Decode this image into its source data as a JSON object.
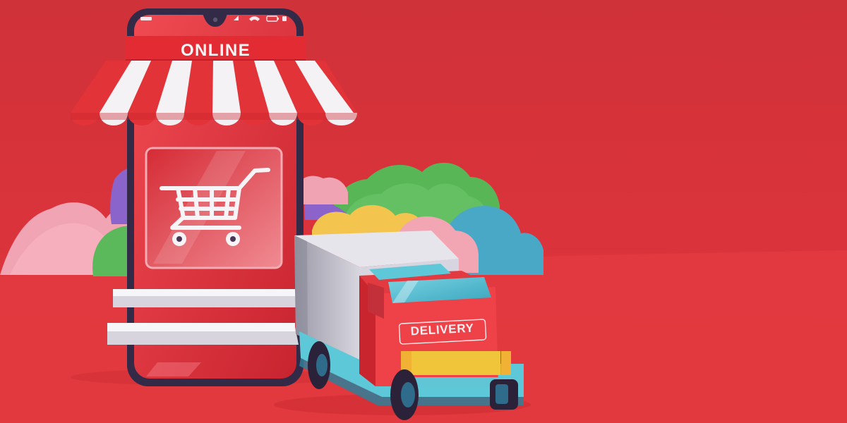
{
  "scene": {
    "sign_text": "ONLINE",
    "truck_text": "DELIVERY",
    "colors": {
      "background_top": "#d8313a",
      "background_bottom": "#e23a40",
      "floor": "#e2383f",
      "sign_red": "#e22b33",
      "awning_red": "#e23438",
      "awning_white": "#f4f2f4",
      "phone_frame": "#332a48",
      "truck_red": "#e33a42",
      "truck_body": "#b9b8c4",
      "truck_blue": "#5ec7d8",
      "cloud_pink": "#f2a6b4",
      "cloud_green": "#59b85a",
      "cloud_purple": "#8a62c9",
      "cloud_blue": "#49a7c6",
      "cloud_yellow": "#f2c44f"
    },
    "icons": {
      "phone": "smartphone-store-icon",
      "cart": "shopping-cart-icon",
      "truck": "delivery-truck-icon"
    }
  }
}
